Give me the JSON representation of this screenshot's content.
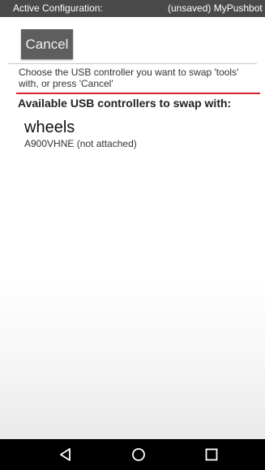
{
  "status_bar": {
    "label": "Active Configuration:",
    "value": "(unsaved) MyPushbot"
  },
  "toolbar": {
    "cancel_label": "Cancel"
  },
  "instruction": "Choose the USB controller you want to swap 'tools' with, or press 'Cancel'",
  "section_title": "Available USB controllers to swap with:",
  "controllers": [
    {
      "name": "wheels",
      "serial": "A900VHNE (not attached)"
    }
  ],
  "nav_bar": {
    "icons": [
      "back-icon",
      "home-icon",
      "recents-icon"
    ]
  },
  "colors": {
    "status_bar": "#4a4a4a",
    "cancel_button": "#5e5e5e",
    "accent_red": "#d9232a",
    "nav_bar": "#000000"
  }
}
